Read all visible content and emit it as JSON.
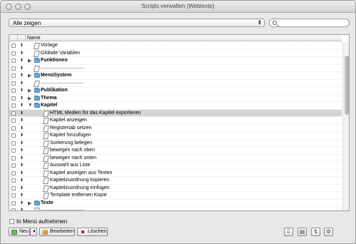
{
  "window": {
    "title": "Scripts verwalten (Webtexte)"
  },
  "filter": {
    "selected": "Alle zeigen"
  },
  "search": {
    "value": ""
  },
  "list": {
    "header_name": "Name",
    "rows": [
      {
        "label": "Vorlage",
        "type": "script",
        "level": 0,
        "bold": false
      },
      {
        "label": "Globale Variablen",
        "type": "script",
        "level": 0,
        "bold": false
      },
      {
        "label": "Funktionen",
        "type": "folder",
        "expanded": false,
        "level": 0,
        "bold": true
      },
      {
        "label": "——————————",
        "type": "separator",
        "level": 0,
        "bold": false
      },
      {
        "label": "MenüSystem",
        "type": "folder",
        "expanded": false,
        "level": 0,
        "bold": true
      },
      {
        "label": "——————————",
        "type": "separator",
        "level": 0,
        "bold": false
      },
      {
        "label": "Publikation",
        "type": "folder",
        "expanded": false,
        "level": 0,
        "bold": true
      },
      {
        "label": "Thema",
        "type": "folder",
        "expanded": false,
        "level": 0,
        "bold": true
      },
      {
        "label": "Kapitel",
        "type": "folder",
        "expanded": true,
        "level": 0,
        "bold": true
      },
      {
        "label": "HTML Medien für das Kapitel exportieren",
        "type": "script",
        "level": 1,
        "bold": false,
        "selected": true
      },
      {
        "label": "Kapitel anzeigen",
        "type": "script",
        "level": 1,
        "bold": false
      },
      {
        "label": "Registertab setzen",
        "type": "script",
        "level": 1,
        "bold": false
      },
      {
        "label": "Kapitel hinzufügen",
        "type": "script",
        "level": 1,
        "bold": false
      },
      {
        "label": "Sortierung belegen",
        "type": "script",
        "level": 1,
        "bold": false
      },
      {
        "label": "bewegen nach oben",
        "type": "script",
        "level": 1,
        "bold": false
      },
      {
        "label": "bewegen nach unten",
        "type": "script",
        "level": 1,
        "bold": false
      },
      {
        "label": "Auswahl aus Liste",
        "type": "script",
        "level": 1,
        "bold": false
      },
      {
        "label": "Kapitel anzeigen aus Texten",
        "type": "script",
        "level": 1,
        "bold": false
      },
      {
        "label": "Kapitelzuordnung kopieren",
        "type": "script",
        "level": 1,
        "bold": false
      },
      {
        "label": "Kapitelzuordnung einfügen",
        "type": "script",
        "level": 1,
        "bold": false
      },
      {
        "label": "Template entfernen Kopie",
        "type": "script",
        "level": 1,
        "bold": false
      },
      {
        "label": "Texte",
        "type": "folder",
        "expanded": false,
        "level": 0,
        "bold": true
      },
      {
        "label": "——————————",
        "type": "separator",
        "level": 0,
        "bold": false
      }
    ]
  },
  "options": {
    "menu_checkbox_label": "In Menü aufnehmen",
    "menu_checked": false
  },
  "buttons": {
    "new": "Neu",
    "edit": "Bearbeiten",
    "delete": "Löschen"
  },
  "icons": [
    "gear-icon",
    "search-icon",
    "folder-icon",
    "script-icon",
    "move-arrows-icon",
    "chevron-down-icon",
    "edit-icon",
    "delete-icon",
    "print-icon",
    "run-icon",
    "import-icon"
  ]
}
